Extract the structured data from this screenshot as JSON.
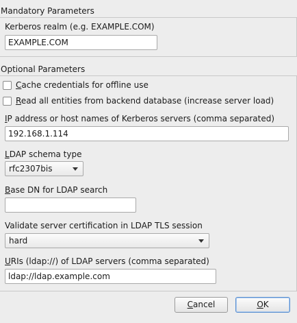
{
  "mandatory": {
    "title": "Mandatory Parameters",
    "realm_label": "Kerberos realm (e.g. EXAMPLE.COM)",
    "realm_value": "EXAMPLE.COM"
  },
  "optional": {
    "title": "Optional Parameters",
    "cache_label_mnemonic": "C",
    "cache_label_rest": "ache credentials for offline use",
    "cache_checked": false,
    "readall_label_mnemonic": "R",
    "readall_label_rest": "ead all entities from backend database (increase server load)",
    "readall_checked": false,
    "servers_label_mnemonic": "I",
    "servers_label_rest": "P address or host names of Kerberos servers (comma separated)",
    "servers_value": "192.168.1.114",
    "schema_label_mnemonic": "L",
    "schema_label_rest": "DAP schema type",
    "schema_value": "rfc2307bis",
    "basedn_label_mnemonic": "B",
    "basedn_label_rest": "ase DN for LDAP search",
    "basedn_value": "",
    "validate_label": "Validate server certification in LDAP TLS session",
    "validate_value": "hard",
    "uris_label_mnemonic": "U",
    "uris_label_rest": "RIs (ldap://) of LDAP servers (comma separated)",
    "uris_value": "ldap://ldap.example.com"
  },
  "buttons": {
    "cancel_mnemonic": "C",
    "cancel_rest": "ancel",
    "ok_mnemonic": "O",
    "ok_rest": "K"
  }
}
